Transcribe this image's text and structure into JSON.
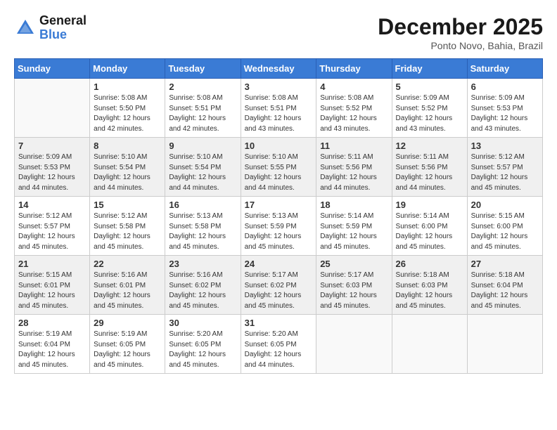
{
  "header": {
    "logo_general": "General",
    "logo_blue": "Blue",
    "month_title": "December 2025",
    "location": "Ponto Novo, Bahia, Brazil"
  },
  "weekdays": [
    "Sunday",
    "Monday",
    "Tuesday",
    "Wednesday",
    "Thursday",
    "Friday",
    "Saturday"
  ],
  "weeks": [
    [
      {
        "day": "",
        "info": ""
      },
      {
        "day": "1",
        "info": "Sunrise: 5:08 AM\nSunset: 5:50 PM\nDaylight: 12 hours\nand 42 minutes."
      },
      {
        "day": "2",
        "info": "Sunrise: 5:08 AM\nSunset: 5:51 PM\nDaylight: 12 hours\nand 42 minutes."
      },
      {
        "day": "3",
        "info": "Sunrise: 5:08 AM\nSunset: 5:51 PM\nDaylight: 12 hours\nand 43 minutes."
      },
      {
        "day": "4",
        "info": "Sunrise: 5:08 AM\nSunset: 5:52 PM\nDaylight: 12 hours\nand 43 minutes."
      },
      {
        "day": "5",
        "info": "Sunrise: 5:09 AM\nSunset: 5:52 PM\nDaylight: 12 hours\nand 43 minutes."
      },
      {
        "day": "6",
        "info": "Sunrise: 5:09 AM\nSunset: 5:53 PM\nDaylight: 12 hours\nand 43 minutes."
      }
    ],
    [
      {
        "day": "7",
        "info": "Sunrise: 5:09 AM\nSunset: 5:53 PM\nDaylight: 12 hours\nand 44 minutes."
      },
      {
        "day": "8",
        "info": "Sunrise: 5:10 AM\nSunset: 5:54 PM\nDaylight: 12 hours\nand 44 minutes."
      },
      {
        "day": "9",
        "info": "Sunrise: 5:10 AM\nSunset: 5:54 PM\nDaylight: 12 hours\nand 44 minutes."
      },
      {
        "day": "10",
        "info": "Sunrise: 5:10 AM\nSunset: 5:55 PM\nDaylight: 12 hours\nand 44 minutes."
      },
      {
        "day": "11",
        "info": "Sunrise: 5:11 AM\nSunset: 5:56 PM\nDaylight: 12 hours\nand 44 minutes."
      },
      {
        "day": "12",
        "info": "Sunrise: 5:11 AM\nSunset: 5:56 PM\nDaylight: 12 hours\nand 44 minutes."
      },
      {
        "day": "13",
        "info": "Sunrise: 5:12 AM\nSunset: 5:57 PM\nDaylight: 12 hours\nand 45 minutes."
      }
    ],
    [
      {
        "day": "14",
        "info": "Sunrise: 5:12 AM\nSunset: 5:57 PM\nDaylight: 12 hours\nand 45 minutes."
      },
      {
        "day": "15",
        "info": "Sunrise: 5:12 AM\nSunset: 5:58 PM\nDaylight: 12 hours\nand 45 minutes."
      },
      {
        "day": "16",
        "info": "Sunrise: 5:13 AM\nSunset: 5:58 PM\nDaylight: 12 hours\nand 45 minutes."
      },
      {
        "day": "17",
        "info": "Sunrise: 5:13 AM\nSunset: 5:59 PM\nDaylight: 12 hours\nand 45 minutes."
      },
      {
        "day": "18",
        "info": "Sunrise: 5:14 AM\nSunset: 5:59 PM\nDaylight: 12 hours\nand 45 minutes."
      },
      {
        "day": "19",
        "info": "Sunrise: 5:14 AM\nSunset: 6:00 PM\nDaylight: 12 hours\nand 45 minutes."
      },
      {
        "day": "20",
        "info": "Sunrise: 5:15 AM\nSunset: 6:00 PM\nDaylight: 12 hours\nand 45 minutes."
      }
    ],
    [
      {
        "day": "21",
        "info": "Sunrise: 5:15 AM\nSunset: 6:01 PM\nDaylight: 12 hours\nand 45 minutes."
      },
      {
        "day": "22",
        "info": "Sunrise: 5:16 AM\nSunset: 6:01 PM\nDaylight: 12 hours\nand 45 minutes."
      },
      {
        "day": "23",
        "info": "Sunrise: 5:16 AM\nSunset: 6:02 PM\nDaylight: 12 hours\nand 45 minutes."
      },
      {
        "day": "24",
        "info": "Sunrise: 5:17 AM\nSunset: 6:02 PM\nDaylight: 12 hours\nand 45 minutes."
      },
      {
        "day": "25",
        "info": "Sunrise: 5:17 AM\nSunset: 6:03 PM\nDaylight: 12 hours\nand 45 minutes."
      },
      {
        "day": "26",
        "info": "Sunrise: 5:18 AM\nSunset: 6:03 PM\nDaylight: 12 hours\nand 45 minutes."
      },
      {
        "day": "27",
        "info": "Sunrise: 5:18 AM\nSunset: 6:04 PM\nDaylight: 12 hours\nand 45 minutes."
      }
    ],
    [
      {
        "day": "28",
        "info": "Sunrise: 5:19 AM\nSunset: 6:04 PM\nDaylight: 12 hours\nand 45 minutes."
      },
      {
        "day": "29",
        "info": "Sunrise: 5:19 AM\nSunset: 6:05 PM\nDaylight: 12 hours\nand 45 minutes."
      },
      {
        "day": "30",
        "info": "Sunrise: 5:20 AM\nSunset: 6:05 PM\nDaylight: 12 hours\nand 45 minutes."
      },
      {
        "day": "31",
        "info": "Sunrise: 5:20 AM\nSunset: 6:05 PM\nDaylight: 12 hours\nand 44 minutes."
      },
      {
        "day": "",
        "info": ""
      },
      {
        "day": "",
        "info": ""
      },
      {
        "day": "",
        "info": ""
      }
    ]
  ]
}
